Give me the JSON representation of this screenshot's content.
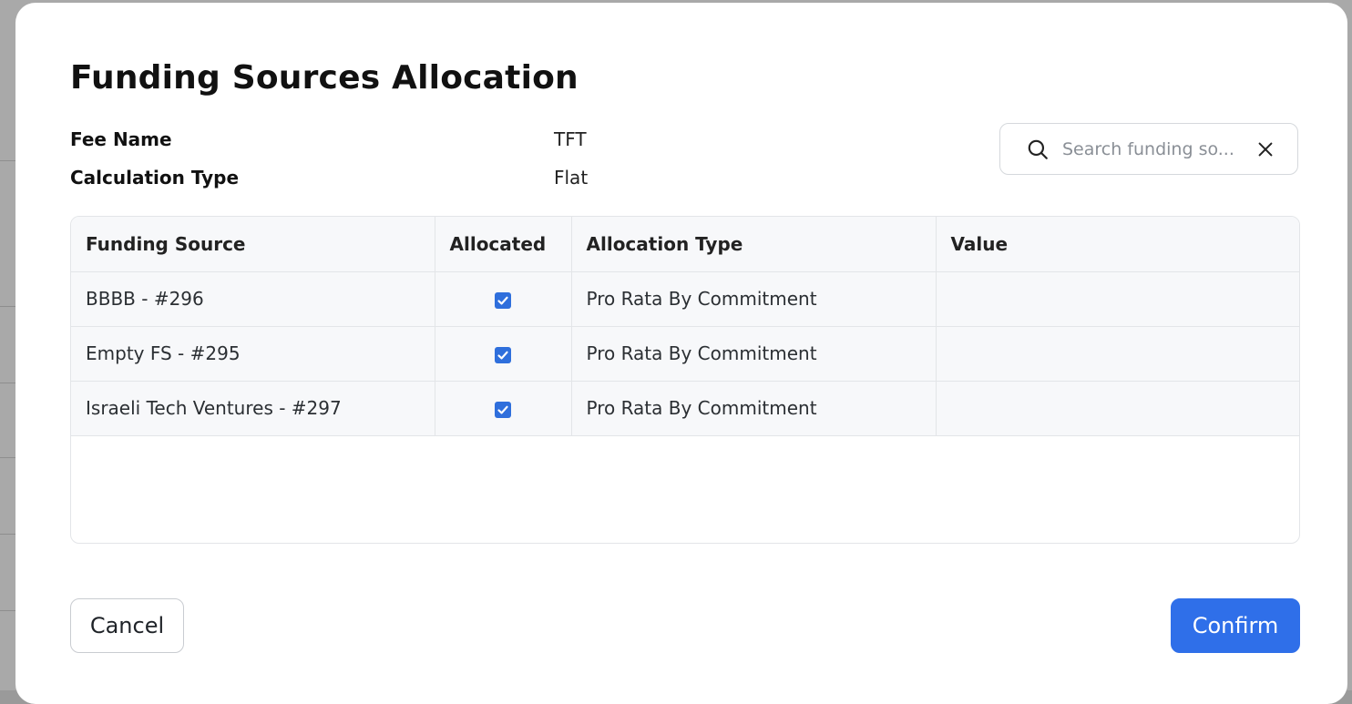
{
  "modal": {
    "title": "Funding Sources Allocation",
    "fee_name_label": "Fee Name",
    "fee_name_value": "TFT",
    "calc_type_label": "Calculation Type",
    "calc_type_value": "Flat"
  },
  "search": {
    "placeholder": "Search funding so...",
    "value": ""
  },
  "table": {
    "columns": [
      "Funding Source",
      "Allocated",
      "Allocation Type",
      "Value"
    ],
    "rows": [
      {
        "source": "BBBB - #296",
        "allocated": true,
        "type": "Pro Rata By Commitment",
        "value": ""
      },
      {
        "source": "Empty FS - #295",
        "allocated": true,
        "type": "Pro Rata By Commitment",
        "value": ""
      },
      {
        "source": "Israeli Tech Ventures - #297",
        "allocated": true,
        "type": "Pro Rata By Commitment",
        "value": ""
      }
    ]
  },
  "footer": {
    "cancel_label": "Cancel",
    "confirm_label": "Confirm"
  },
  "colors": {
    "accent": "#2f6fe9",
    "checkbox": "#2f6fdc",
    "header_bg": "#f7f8fa",
    "overlay": "#a9a9a9"
  },
  "icons": {
    "search": "search-icon",
    "clear": "close-icon",
    "check": "checkmark-icon"
  }
}
